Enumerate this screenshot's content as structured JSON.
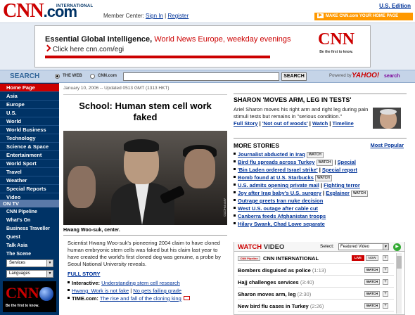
{
  "header": {
    "logo_text": "CNN",
    "logo_suffix": ".com",
    "edition_tag": "INTERNATIONAL",
    "member_center_label": "Member Center:",
    "sign_in": "Sign In",
    "separator": "|",
    "register": "Register",
    "us_edition": "U.S. Edition",
    "homepage_button": "MAKE CNN.com YOUR HOME PAGE"
  },
  "banner": {
    "title": "Essential Global Intelligence,",
    "title_red": "World News Europe, weekday evenings",
    "subtitle": "Click here cnn.com/egi",
    "logo": "CNN",
    "tagline": "Be the first to know."
  },
  "search": {
    "label": "SEARCH",
    "option_web": "THE WEB",
    "option_cnn": "CNN.com",
    "input_value": "",
    "button": "SEARCH",
    "powered_by": "Powered by",
    "provider": "YAHOO!",
    "provider_suffix": "search"
  },
  "leftnav": {
    "items": [
      {
        "label": "Home Page",
        "active": true
      },
      {
        "label": "Asia"
      },
      {
        "label": "Europe"
      },
      {
        "label": "U.S."
      },
      {
        "label": "World"
      },
      {
        "label": "World Business"
      },
      {
        "label": "Technology"
      },
      {
        "label": "Science & Space"
      },
      {
        "label": "Entertainment"
      },
      {
        "label": "World Sport"
      },
      {
        "label": "Travel"
      },
      {
        "label": "Weather"
      },
      {
        "label": "Special Reports"
      },
      {
        "label": "Video"
      }
    ],
    "on_tv_header": "ON TV",
    "tv_items": [
      "CNN Pipeline",
      "What's On",
      "Business Traveller",
      "Quest",
      "Talk Asia",
      "The Scene"
    ],
    "select_services": "Services",
    "select_languages": "Languages",
    "logo": "CNN",
    "logo_tagline": "Be the first to know."
  },
  "main": {
    "dateline": "January 10, 2006 -- Updated 0513 GMT (1313 HKT)",
    "headline_line1": "School: Human stem cell work",
    "headline_line2": "faked",
    "photo_credit": "AFP PHOTO",
    "caption": "Hwang Woo-suk, center.",
    "story": "Scientist Hwang Woo-suk's pioneering 2004 claim to have cloned human embryonic stem cells was faked but his claim last year to have created the world's first cloned dog was genuine, a probe by Seoul National University reveals.",
    "full_story": "FULL STORY",
    "links": [
      {
        "prefix": "Interactive:",
        "text": "Understanding stem cell research"
      },
      {
        "prefix": "",
        "text": "Hwang: Work is not fake",
        "sep": "|",
        "text2": "No gets failing grade"
      },
      {
        "prefix": "TIME.com:",
        "text": "The rise and fall of the cloning king"
      }
    ]
  },
  "right": {
    "sharon_title": "SHARON 'MOVES ARM, LEG IN TESTS'",
    "sharon_text": "Ariel Sharon moves his right arm and right leg during pain stimuli tests but remains in \"serious condition.\"",
    "sharon_links": [
      "Full Story",
      "'Not out of woods'",
      "Watch",
      "Timeline"
    ],
    "more_title": "MORE STORIES",
    "most_popular": "Most Popular",
    "watch_tag": "WATCH",
    "stories": [
      {
        "text": "Journalist abducted in Iraq",
        "watch": true,
        "extra": ""
      },
      {
        "text": "Bird flu spreads across Turkey",
        "watch": true,
        "extra": "Special"
      },
      {
        "text": "'Bin Laden ordered Israel strike'",
        "watch": false,
        "extra": "Special report"
      },
      {
        "text": "Bomb found at U.S. Starbucks",
        "watch": true,
        "extra": ""
      },
      {
        "text": "U.S. admits opening private mail",
        "watch": false,
        "extra": "Fighting terror"
      },
      {
        "text": "Joy after Iraq baby's U.S. surgery",
        "watch": false,
        "extra": "Explainer",
        "watch_after": true
      },
      {
        "text": "Outrage greets Iran nuke decision",
        "watch": false,
        "extra": ""
      },
      {
        "text": "West U.S. outage after cable cut",
        "watch": false,
        "extra": ""
      },
      {
        "text": "Canberra feeds Afghanistan troops",
        "watch": false,
        "extra": ""
      },
      {
        "text": "Hilary Swank, Chad Lowe separate",
        "watch": false,
        "extra": ""
      }
    ]
  },
  "watch_video": {
    "title_watch": "WATCH",
    "title_video": "VIDEO",
    "select_label": "Select:",
    "select_value": "Featured Video",
    "go": "▶",
    "pipeline_tag": "CNN Pipeline",
    "live_label": "LIVE",
    "now_label": "NOW",
    "watch_label": "WATCH",
    "items": [
      {
        "title": "CNN INTERNATIONAL",
        "duration": "",
        "live": true
      },
      {
        "title": "Bombers disguised as police",
        "duration": "(1:13)"
      },
      {
        "title": "Hajj challenges services",
        "duration": "(3:40)"
      },
      {
        "title": "Sharon moves arm, leg",
        "duration": "(2:30)"
      },
      {
        "title": "New bird flu cases in Turkey",
        "duration": "(2:26)"
      }
    ]
  },
  "colors": {
    "brand_red": "#cc0000",
    "nav_blue": "#003366",
    "link_blue": "#003399",
    "search_bar": "#c5d4e8"
  }
}
